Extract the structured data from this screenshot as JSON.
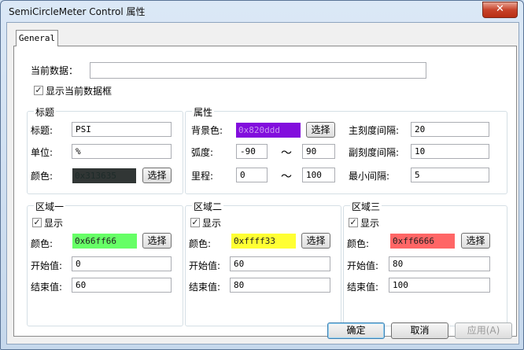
{
  "window": {
    "title": "SemiCircleMeter Control 属性",
    "close_glyph": "✕"
  },
  "tab": {
    "label": "General"
  },
  "current_data": {
    "label": "当前数据：",
    "value": "",
    "show_label": "显示当前数据框",
    "show_checked": true
  },
  "title_group": {
    "title": "标题",
    "title_label": "标题:",
    "title_value": "PSI",
    "unit_label": "单位:",
    "unit_value": "%",
    "color_label": "颜色:",
    "color_value": "0x313635",
    "color_hex": "#313635",
    "choose": "选择"
  },
  "attr_group": {
    "title": "属性",
    "bg_label": "背景色:",
    "bg_value": "0x820ddd",
    "bg_hex": "#820ddd",
    "choose": "选择",
    "arc_label": "弧度:",
    "arc_from": "-90",
    "arc_to": "90",
    "range_label": "里程:",
    "range_from": "0",
    "range_to": "100",
    "tilde": "～",
    "major_label": "主刻度间隔:",
    "major_value": "20",
    "minor_label": "副刻度间隔:",
    "minor_value": "10",
    "min_label": "最小间隔:",
    "min_value": "5"
  },
  "zones": [
    {
      "title": "区域一",
      "show_label": "显示",
      "show_checked": true,
      "color_label": "颜色:",
      "color_value": "0x66ff66",
      "color_hex": "#66ff66",
      "choose": "选择",
      "start_label": "开始值:",
      "start_value": "0",
      "end_label": "结束值:",
      "end_value": "60"
    },
    {
      "title": "区域二",
      "show_label": "显示",
      "show_checked": true,
      "color_label": "颜色:",
      "color_value": "0xffff33",
      "color_hex": "#ffff33",
      "choose": "选择",
      "start_label": "开始值:",
      "start_value": "60",
      "end_label": "结束值:",
      "end_value": "80"
    },
    {
      "title": "区域三",
      "show_label": "显示",
      "show_checked": true,
      "color_label": "颜色:",
      "color_value": "0xff6666",
      "color_hex": "#ff6666",
      "choose": "选择",
      "start_label": "开始值:",
      "start_value": "80",
      "end_label": "结束值:",
      "end_value": "100"
    }
  ],
  "footer": {
    "ok": "确定",
    "cancel": "取消",
    "apply": "应用(A)"
  }
}
